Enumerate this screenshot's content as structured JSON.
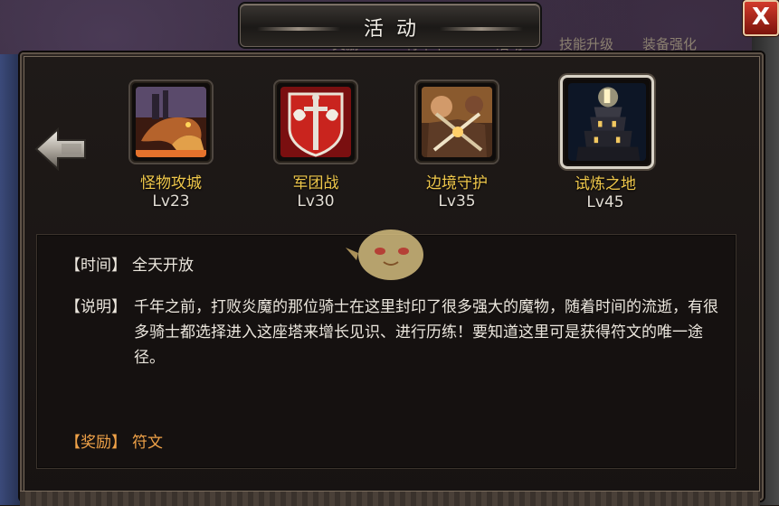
{
  "header": {
    "title": "活动",
    "close_label": "X"
  },
  "background_tabs": [
    "奖励",
    "将军本",
    "活动",
    "技能升级",
    "装备强化"
  ],
  "activities": [
    {
      "name": "怪物攻城",
      "level": "Lv23",
      "icon": "dragon-icon"
    },
    {
      "name": "军团战",
      "level": "Lv30",
      "icon": "sword-crest-icon"
    },
    {
      "name": "边境守护",
      "level": "Lv35",
      "icon": "crossed-swords-icon"
    },
    {
      "name": "试炼之地",
      "level": "Lv45",
      "icon": "tower-icon",
      "selected": true
    }
  ],
  "details": {
    "time_label": "【时间】",
    "time_value": "全天开放",
    "desc_label": "【说明】",
    "desc_value": "千年之前，打败炎魔的那位骑士在这里封印了很多强大的魔物，随着时间的流逝，有很多骑士都选择进入这座塔来增长见识、进行历练！要知道这里可是获得符文的唯一途径。",
    "reward_label": "【奖励】",
    "reward_value": "符文"
  },
  "colors": {
    "activity_name": "#f0c84b",
    "reward": "#f0a248",
    "text": "#ece7de",
    "close_button": "#c02a1c"
  }
}
